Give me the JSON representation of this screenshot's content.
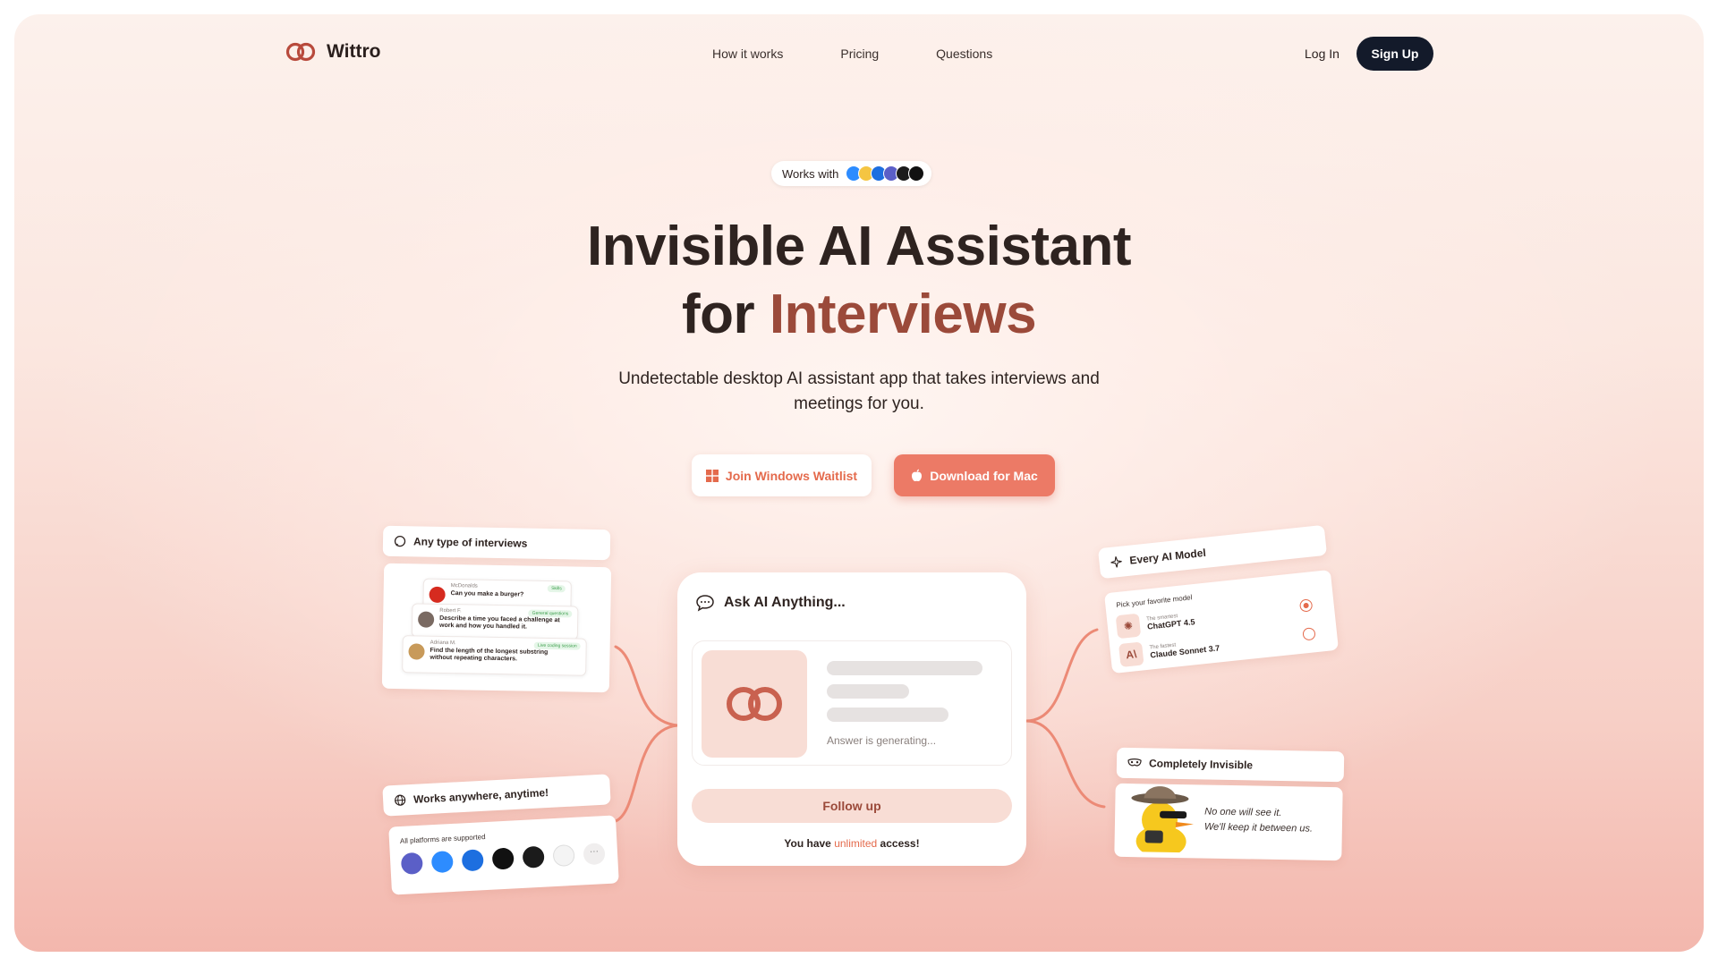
{
  "brand": {
    "name": "Wittro"
  },
  "nav": {
    "links": [
      "How it works",
      "Pricing",
      "Questions"
    ],
    "login": "Log In",
    "signup": "Sign Up"
  },
  "hero": {
    "works_with": "Works with",
    "works_with_icons": [
      "zoom-icon",
      "google-meet-icon",
      "webex-icon",
      "teams-icon",
      "hackerrank-icon",
      "leetcode-icon"
    ],
    "title_line1": "Invisible AI Assistant",
    "title_line2_prefix": "for ",
    "title_line2_accent": "Interviews",
    "subtitle_line1": "Undetectable desktop AI assistant app that takes interviews and",
    "subtitle_line2": "meetings for you.",
    "btn_windows": "Join Windows Waitlist",
    "btn_mac": "Download for Mac"
  },
  "center_card": {
    "title": "Ask AI Anything...",
    "generating": "Answer is generating...",
    "follow_up": "Follow up",
    "access_prefix": "You have ",
    "access_accent": "unlimited",
    "access_suffix": " access!"
  },
  "interviews_card": {
    "label": "Any type of interviews",
    "rows": [
      {
        "name": "McDonalds",
        "question": "Can you make a burger?",
        "tag": "Skills"
      },
      {
        "name": "Robert F.",
        "question": "Describe a time you faced a challenge at work and how you handled it.",
        "tag": "General questions"
      },
      {
        "name": "Adriana M.",
        "question": "Find the length of the longest substring without repeating characters.",
        "tag": "Live coding session"
      }
    ]
  },
  "anywhere_card": {
    "label": "Works anywhere, anytime!",
    "caption": "All platforms are supported",
    "icons": [
      "teams-icon",
      "zoom-icon",
      "webex-icon",
      "leetcode-icon",
      "hackerrank-icon",
      "google-meet-icon",
      "more-icon"
    ]
  },
  "model_card": {
    "label": "Every AI Model",
    "caption": "Pick your favorite model",
    "models": [
      {
        "sub": "The smartest",
        "name": "ChatGPT 4.5",
        "selected": true
      },
      {
        "sub": "The fastest",
        "name": "Claude Sonnet 3.7",
        "selected": false
      }
    ]
  },
  "invisible_card": {
    "label": "Completely Invisible",
    "quote_line1": "No one will see it.",
    "quote_line2": "We'll keep it between us."
  },
  "colors": {
    "accent": "#e46a4c",
    "brand_dark": "#9b4a3a",
    "button_dark": "#131a2a",
    "mac_button": "#ec7a66"
  }
}
